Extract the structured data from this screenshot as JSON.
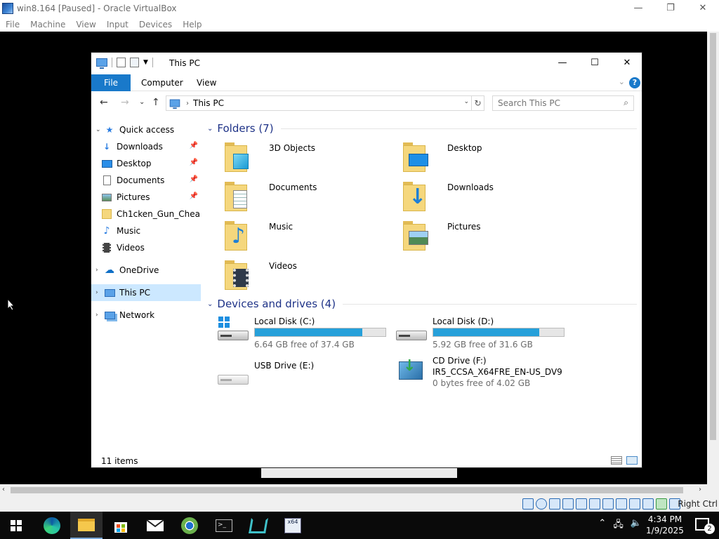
{
  "host": {
    "title": "win8.164 [Paused] - Oracle VirtualBox",
    "menu": [
      "File",
      "Machine",
      "View",
      "Input",
      "Devices",
      "Help"
    ],
    "win_buttons": {
      "minimize": "—",
      "restore": "❐",
      "close": "✕"
    },
    "host_key": "Right Ctrl"
  },
  "explorer": {
    "title": "This PC",
    "win_buttons": {
      "minimize": "—",
      "maximize": "☐",
      "close": "✕"
    },
    "ribbon": {
      "file": "File",
      "tabs": [
        "Computer",
        "View"
      ],
      "help": "?"
    },
    "nav": {
      "back": "←",
      "forward": "→",
      "recent": "⌄",
      "up": "↑",
      "address": "This PC",
      "refresh": "↻",
      "search_placeholder": "Search This PC"
    },
    "navpane": {
      "quick_access": "Quick access",
      "items": [
        {
          "label": "Downloads",
          "icon": "download-icon",
          "pinned": true
        },
        {
          "label": "Desktop",
          "icon": "desktop-icon",
          "pinned": true
        },
        {
          "label": "Documents",
          "icon": "documents-icon",
          "pinned": true
        },
        {
          "label": "Pictures",
          "icon": "pictures-icon",
          "pinned": true
        },
        {
          "label": "Ch1cken_Gun_Chea",
          "icon": "folder-icon",
          "pinned": false
        },
        {
          "label": "Music",
          "icon": "music-icon",
          "pinned": false
        },
        {
          "label": "Videos",
          "icon": "videos-icon",
          "pinned": false
        }
      ],
      "onedrive": "OneDrive",
      "this_pc": "This PC",
      "network": "Network"
    },
    "folders_header": "Folders (7)",
    "folders": [
      {
        "name": "3D Objects",
        "icon": "3d-objects-icon"
      },
      {
        "name": "Desktop",
        "icon": "desktop-folder-icon"
      },
      {
        "name": "Documents",
        "icon": "documents-folder-icon"
      },
      {
        "name": "Downloads",
        "icon": "downloads-folder-icon"
      },
      {
        "name": "Music",
        "icon": "music-folder-icon"
      },
      {
        "name": "Pictures",
        "icon": "pictures-folder-icon"
      },
      {
        "name": "Videos",
        "icon": "videos-folder-icon"
      }
    ],
    "drives_header": "Devices and drives (4)",
    "drives": [
      {
        "name": "Local Disk (C:)",
        "free": "6.64 GB free of 37.4 GB",
        "used_fraction": 0.82,
        "icon": "windows-drive-icon"
      },
      {
        "name": "Local Disk (D:)",
        "free": "5.92 GB free of 31.6 GB",
        "used_fraction": 0.81,
        "icon": "hard-drive-icon"
      },
      {
        "name": "USB Drive (E:)",
        "icon": "usb-drive-icon"
      },
      {
        "name": "CD Drive (F:)",
        "label": "IR5_CCSA_X64FRE_EN-US_DV9",
        "free": "0 bytes free of 4.02 GB",
        "icon": "cd-drive-icon"
      }
    ],
    "status": "11 items"
  },
  "taskbar": {
    "time": "4:34 PM",
    "date": "1/9/2025",
    "notifications": "2"
  },
  "colors": {
    "accent": "#1979ca",
    "selection": "#cce8ff",
    "drive_bar": "#26a0da",
    "group_header": "#1e3287"
  }
}
